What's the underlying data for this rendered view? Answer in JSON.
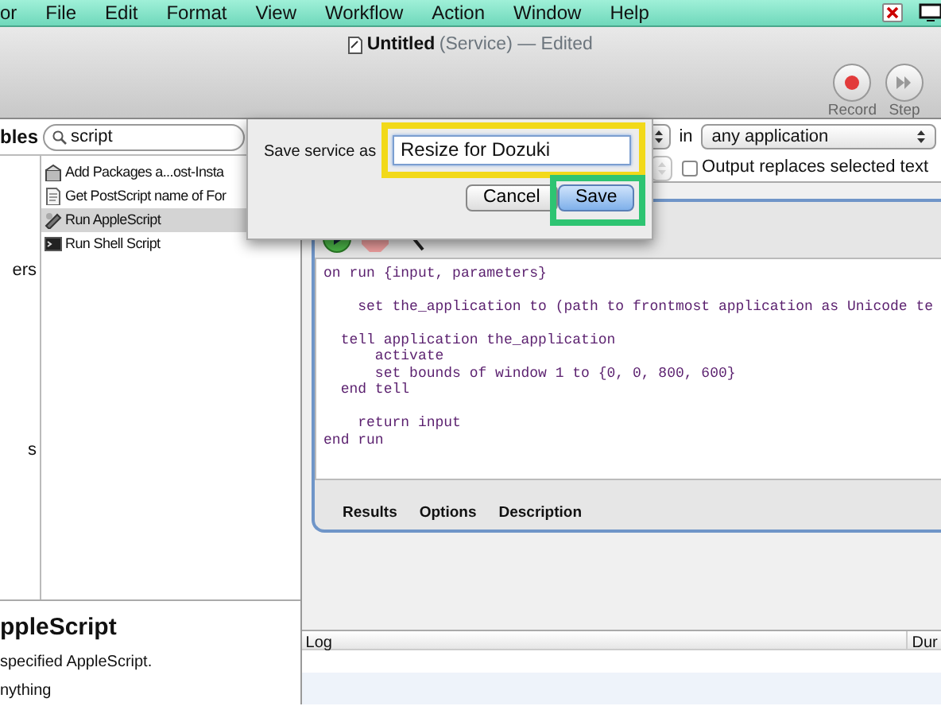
{
  "menu_bar": {
    "items": [
      "or",
      "File",
      "Edit",
      "Format",
      "View",
      "Workflow",
      "Action",
      "Window",
      "Help"
    ]
  },
  "window": {
    "title": "Untitled",
    "subtitle": "(Service) — Edited"
  },
  "toolbar": {
    "buttons": [
      {
        "label": "Record",
        "kind": "record"
      },
      {
        "label": "Step",
        "kind": "step"
      }
    ]
  },
  "library": {
    "tab": "bles",
    "search": {
      "value": "script"
    },
    "categories": [
      "ers",
      "s"
    ],
    "actions": [
      {
        "label": "Add Packages a...ost-Insta",
        "kind": "package",
        "selected": false
      },
      {
        "label": "Get PostScript name of For",
        "kind": "document",
        "selected": false
      },
      {
        "label": "Run AppleScript",
        "kind": "script",
        "selected": true
      },
      {
        "label": "Run Shell Script",
        "kind": "terminal",
        "selected": false
      }
    ]
  },
  "description": {
    "title": "ppleScript",
    "text": "specified AppleScript.",
    "more": "nything"
  },
  "service": {
    "in_label": "in",
    "application": "any application",
    "output_replaces": {
      "label": "Output replaces selected text",
      "checked": false
    }
  },
  "dialog": {
    "label": "Save service as",
    "field": {
      "value": "Resize for Dozuki",
      "highlight": {
        "color": "#f2d91a"
      }
    },
    "buttons": [
      {
        "label": "Cancel",
        "default": false
      },
      {
        "label": "Save",
        "default": true,
        "highlight": {
          "color": "#2ec472"
        }
      }
    ]
  },
  "action": {
    "script": "on run {input, parameters}\n\n    set the_application to (path to frontmost application as Unicode te\n\n  tell application the_application\n      activate\n      set bounds of window 1 to {0, 0, 800, 600}\n  end tell\n\n    return input\nend run",
    "tabs": [
      "Results",
      "Options",
      "Description"
    ]
  },
  "log": {
    "columns": [
      "Log",
      "Dur"
    ]
  }
}
